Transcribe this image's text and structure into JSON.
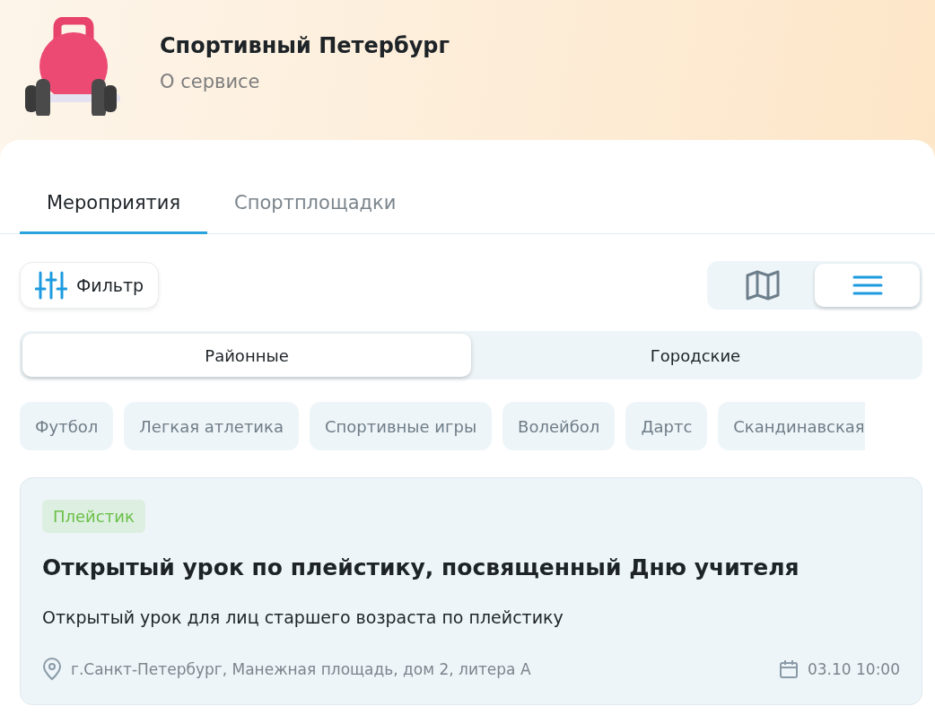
{
  "header": {
    "title": "Спортивный Петербург",
    "subtitle": "О сервисе"
  },
  "tabs": [
    {
      "label": "Мероприятия",
      "selected": true
    },
    {
      "label": "Спортплощадки",
      "selected": false
    }
  ],
  "filter_button": {
    "label": "Фильтр"
  },
  "view_toggle": [
    {
      "kind": "map",
      "selected": false
    },
    {
      "kind": "list",
      "selected": true
    }
  ],
  "segments": [
    {
      "label": "Районные",
      "selected": true
    },
    {
      "label": "Городские",
      "selected": false
    }
  ],
  "categories": [
    {
      "label": "Футбол"
    },
    {
      "label": "Легкая атлетика"
    },
    {
      "label": "Спортивные игры"
    },
    {
      "label": "Волейбол"
    },
    {
      "label": "Дартс"
    },
    {
      "label": "Скандинавская"
    }
  ],
  "events": [
    {
      "tag": "Плейстик",
      "title": "Открытый урок по плейстику, посвященный Дню учителя",
      "description": "Открытый урок для лиц старшего возраста по плейстику",
      "address": "г.Санкт-Петербург, Манежная площадь, дом 2, литера А",
      "datetime": "03.10 10:00"
    }
  ]
}
